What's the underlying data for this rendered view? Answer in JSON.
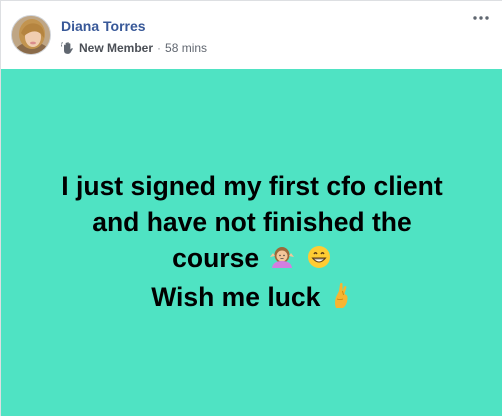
{
  "post": {
    "author_name": "Diana Torres",
    "badge": "New Member",
    "separator": "·",
    "timestamp": "58 mins",
    "background_color": "#4fe3c3",
    "text_lines": [
      "I just signed my first cfo client",
      "and have not finished the",
      "course",
      "Wish me luck"
    ],
    "icons": {
      "badge": "waving-hand-icon",
      "more": "more-options-icon",
      "line3_emojis": [
        "shrugging-woman-emoji",
        "grinning-face-emoji"
      ],
      "line4_emoji": "crossed-fingers-emoji"
    }
  }
}
